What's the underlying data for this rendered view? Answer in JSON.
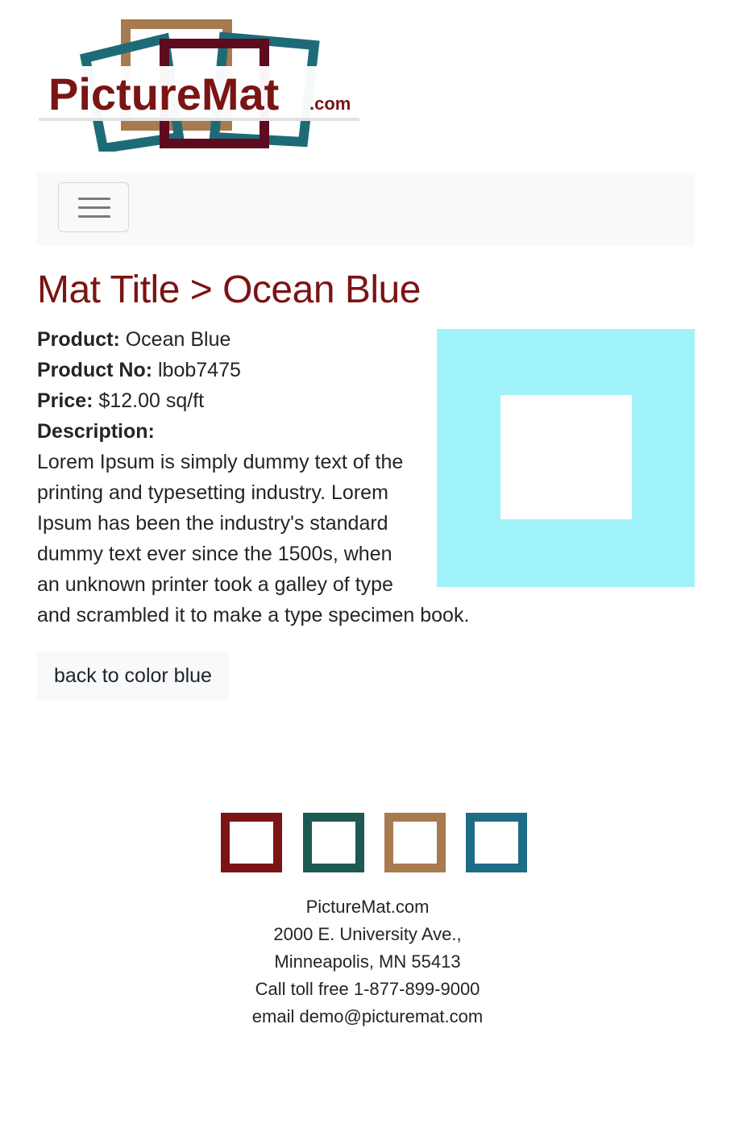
{
  "logo": {
    "text_main": "PictureMat",
    "text_suffix": ".com",
    "colors": {
      "tan": "#a87a4f",
      "teal": "#1e6b78",
      "maroon": "#5e0a1f",
      "text": "#7b1414"
    }
  },
  "navbar": {
    "toggle_icon": "hamburger-icon"
  },
  "page_title": "Mat Title > Ocean Blue",
  "product": {
    "product_label": "Product:",
    "product_value": "Ocean Blue",
    "number_label": "Product No:",
    "number_value": "lbob7475",
    "price_label": "Price:",
    "price_value": "$12.00 sq/ft",
    "description_label": "Description:",
    "description": "Lorem Ipsum is simply dummy text of the printing and typesetting industry. Lorem Ipsum has been the industry's standard dummy text ever since the 1500s, when an unknown printer took a galley of type and scrambled it to make a type specimen book.",
    "swatch_color": "#a0f3f8"
  },
  "back_button": "back to color blue",
  "footer": {
    "icon_colors": [
      "#7b1414",
      "#1d5a52",
      "#a87a4f",
      "#1e6c86"
    ],
    "company": "PictureMat.com",
    "address1": "2000 E. University Ave.,",
    "address2": "Minneapolis, MN 55413",
    "phone": "Call toll free 1-877-899-9000",
    "email": "email demo@picturemat.com"
  }
}
